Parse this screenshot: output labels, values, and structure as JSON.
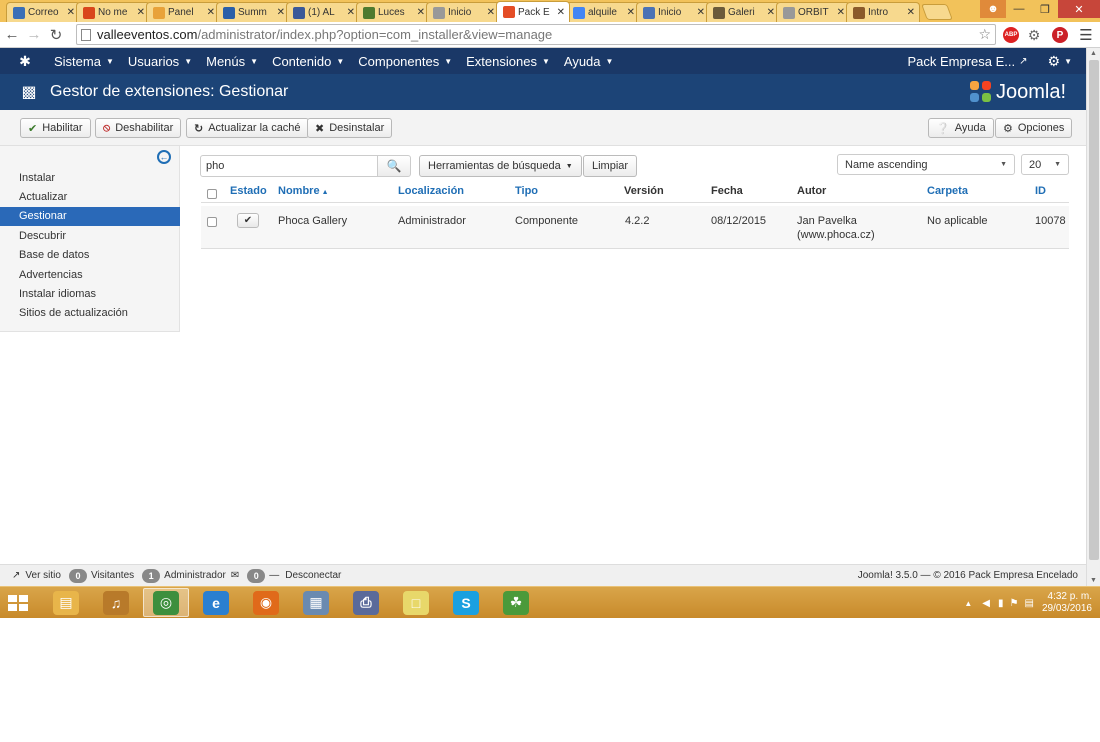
{
  "browser": {
    "tabs": [
      {
        "label": "Correo",
        "icon": "mail-icon",
        "color": "#3b6fb6"
      },
      {
        "label": "No me",
        "icon": "weebly-icon",
        "color": "#d9461b"
      },
      {
        "label": "Panel",
        "icon": "panel-icon",
        "color": "#e8a23a"
      },
      {
        "label": "Summ",
        "icon": "globe-icon",
        "color": "#2a5fa8"
      },
      {
        "label": "(1) AL",
        "icon": "facebook-icon",
        "color": "#3b5998"
      },
      {
        "label": "Luces",
        "icon": "luces-icon",
        "color": "#4e7a2f"
      },
      {
        "label": "Inicio",
        "icon": "page-icon",
        "color": "#999999"
      },
      {
        "label": "Pack E",
        "icon": "joomla-icon",
        "color": "#e44d26"
      },
      {
        "label": "alquile",
        "icon": "google-icon",
        "color": "#4285f4"
      },
      {
        "label": "Inicio",
        "icon": "inicio-icon",
        "color": "#4a72b5"
      },
      {
        "label": "Galeri",
        "icon": "galeria-icon",
        "color": "#6b5a3a"
      },
      {
        "label": "ORBIT",
        "icon": "page-icon",
        "color": "#999999"
      },
      {
        "label": "Intro",
        "icon": "intro-icon",
        "color": "#8a5a2a"
      }
    ],
    "url_host": "valleeventos.com",
    "url_path": "/administrator/index.php?option=com_installer&view=manage"
  },
  "joomla": {
    "nav": [
      {
        "label": "Sistema"
      },
      {
        "label": "Usuarios"
      },
      {
        "label": "Menús"
      },
      {
        "label": "Contenido"
      },
      {
        "label": "Componentes"
      },
      {
        "label": "Extensiones"
      },
      {
        "label": "Ayuda"
      }
    ],
    "site_name": "Pack Empresa E...",
    "page_title": "Gestor de extensiones: Gestionar",
    "brand": "Joomla!",
    "toolbar": {
      "enable": "Habilitar",
      "disable": "Deshabilitar",
      "refresh": "Actualizar la caché",
      "uninstall": "Desinstalar",
      "help": "Ayuda",
      "options": "Opciones"
    },
    "sidebar": [
      {
        "label": "Instalar"
      },
      {
        "label": "Actualizar"
      },
      {
        "label": "Gestionar",
        "active": true
      },
      {
        "label": "Descubrir"
      },
      {
        "label": "Base de datos"
      },
      {
        "label": "Advertencias"
      },
      {
        "label": "Instalar idiomas"
      },
      {
        "label": "Sitios de actualización"
      }
    ],
    "filters": {
      "search_value": "pho",
      "search_tools": "Herramientas de búsqueda",
      "clear": "Limpiar",
      "ordering": "Name ascending",
      "limit": "20"
    },
    "table": {
      "headers": {
        "status": "Estado",
        "name": "Nombre",
        "location": "Localización",
        "type": "Tipo",
        "version": "Versión",
        "date": "Fecha",
        "author": "Autor",
        "folder": "Carpeta",
        "id": "ID"
      },
      "rows": [
        {
          "name": "Phoca Gallery",
          "location": "Administrador",
          "type": "Componente",
          "version": "4.2.2",
          "date": "08/12/2015",
          "author_line1": "Jan Pavelka",
          "author_line2": "(www.phoca.cz)",
          "folder": "No aplicable",
          "id": "10078"
        }
      ]
    },
    "footer": {
      "view_site": "Ver sitio",
      "visitors_count": "0",
      "visitors_label": "Visitantes",
      "admins_count": "1",
      "admins_label": "Administrador",
      "msgs_count": "0",
      "logout": "Desconectar",
      "copyright": "Joomla! 3.5.0  —  © 2016 Pack Empresa Encelado"
    }
  },
  "taskbar": {
    "time": "4:32 p. m.",
    "date": "29/03/2016",
    "apps": [
      {
        "name": "file-explorer",
        "color": "#e8b54a"
      },
      {
        "name": "itunes",
        "color": "#b87a2a"
      },
      {
        "name": "chrome",
        "color": "#3d8f3d"
      },
      {
        "name": "internet-explorer",
        "color": "#2a7fd0"
      },
      {
        "name": "firefox",
        "color": "#e06a1a"
      },
      {
        "name": "calculator",
        "color": "#6a8ab0"
      },
      {
        "name": "network-tool",
        "color": "#5a6a9a"
      },
      {
        "name": "sticky-notes",
        "color": "#e8d86a"
      },
      {
        "name": "skype",
        "color": "#1aa0e0"
      },
      {
        "name": "green-app",
        "color": "#4a9a3a"
      }
    ]
  }
}
